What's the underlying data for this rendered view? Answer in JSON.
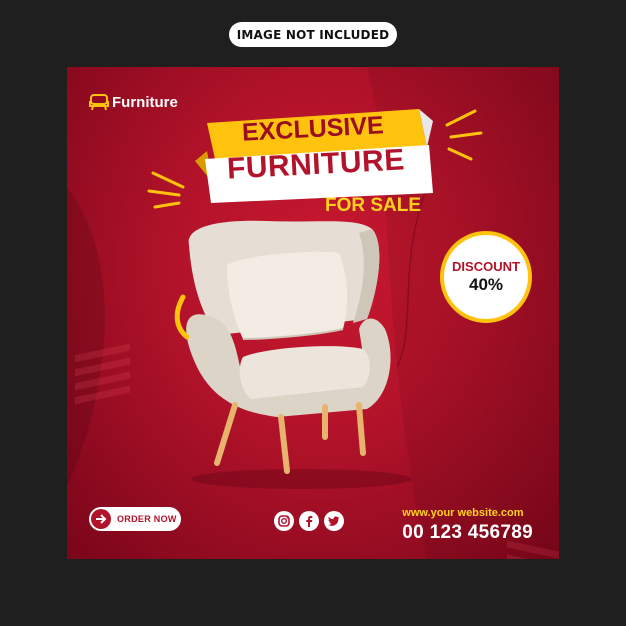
{
  "top_pill": {
    "text": "IMAGE NOT INCLUDED"
  },
  "poster": {
    "logo_text": "Furniture",
    "headline_1": "EXCLUSIVE",
    "headline_2": "FURNITURE",
    "headline_3": "FOR SALE",
    "discount_label": "DISCOUNT",
    "discount_value": "40%",
    "order_button": "ORDER NOW",
    "website": "www.your website.com",
    "phone": "00 123 456789",
    "socials": [
      "instagram-icon",
      "facebook-icon",
      "twitter-icon"
    ]
  },
  "colors": {
    "background": "#1f1f1f",
    "poster_red": "#b3132a",
    "accent_yellow": "#ffc30e",
    "white": "#ffffff"
  }
}
